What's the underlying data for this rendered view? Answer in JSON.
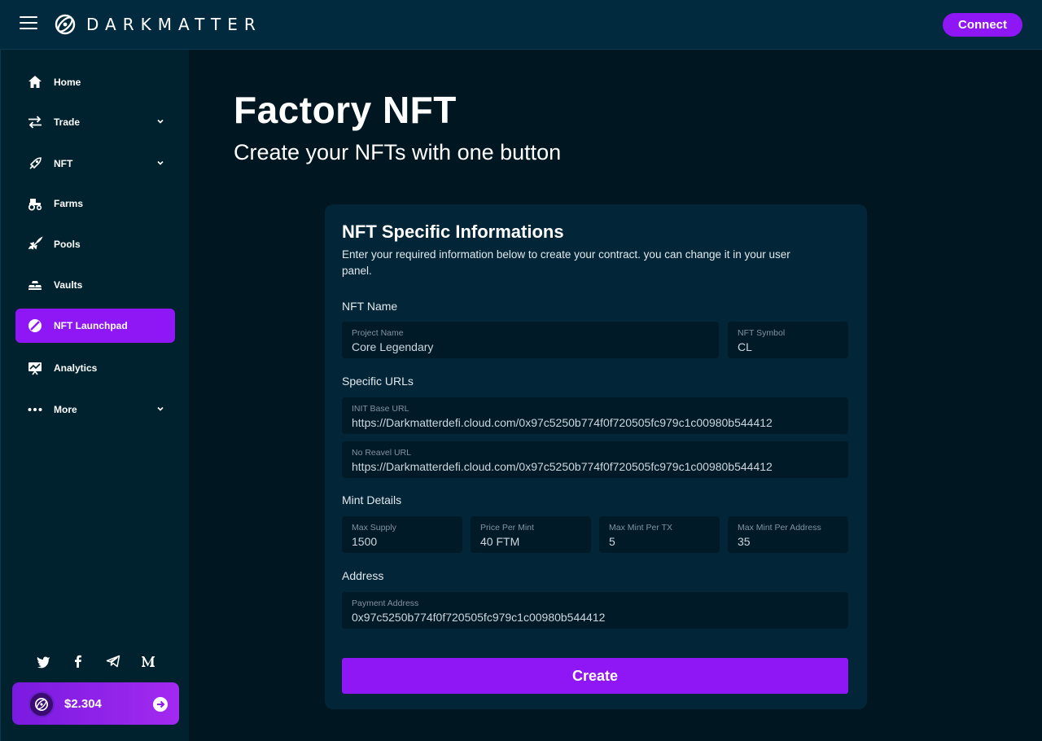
{
  "brand": {
    "name": "DARKMATTER"
  },
  "header": {
    "connect_label": "Connect"
  },
  "sidebar": {
    "items": [
      {
        "label": "Home",
        "icon": "home-icon"
      },
      {
        "label": "Trade",
        "icon": "swap-arrows-icon"
      },
      {
        "label": "NFT",
        "icon": "nft-icon"
      },
      {
        "label": "Farms",
        "icon": "tractor-icon"
      },
      {
        "label": "Pools",
        "icon": "rocket-icon"
      },
      {
        "label": "Vaults",
        "icon": "gold-bars-icon"
      },
      {
        "label": "NFT Launchpad",
        "icon": "launchpad-icon",
        "active": true
      },
      {
        "label": "Analytics",
        "icon": "analytics-icon"
      },
      {
        "label": "More",
        "icon": "more-dots-icon"
      }
    ],
    "socials": [
      "twitter-icon",
      "facebook-icon",
      "telegram-icon",
      "medium-icon"
    ],
    "price": "$2.304"
  },
  "main": {
    "title": "Factory NFT",
    "subtitle": "Create your NFTs with one button"
  },
  "form": {
    "title": "NFT Specific Informations",
    "description": "Enter your required information below to create your contract. you can change it in your user panel.",
    "sections": {
      "name": "NFT Name",
      "urls": "Specific URLs",
      "mint": "Mint Details",
      "address": "Address"
    },
    "fields": {
      "project_name": {
        "label": "Project Name",
        "value": "Core Legendary"
      },
      "symbol": {
        "label": "NFT Symbol",
        "value": "CL"
      },
      "init_base_url": {
        "label": "INIT Base URL",
        "value": "https://Darkmatterdefi.cloud.com/0x97c5250b774f0f720505fc979c1c00980b544412"
      },
      "no_reveal_url": {
        "label": "No Reavel URL",
        "value": "https://Darkmatterdefi.cloud.com/0x97c5250b774f0f720505fc979c1c00980b544412"
      },
      "max_supply": {
        "label": "Max Supply",
        "value": "1500"
      },
      "price_per_mint": {
        "label": "Price Per Mint",
        "value": "40 FTM"
      },
      "max_mint_tx": {
        "label": "Max Mint Per TX",
        "value": "5"
      },
      "max_mint_address": {
        "label": "Max Mint Per Address",
        "value": "35"
      },
      "payment_address": {
        "label": "Payment Address",
        "value": "0x97c5250b774f0f720505fc979c1c00980b544412"
      }
    },
    "create_label": "Create"
  },
  "colors": {
    "accent": "#8f17f5",
    "background": "#001722",
    "card": "#022537",
    "field": "#001a27"
  }
}
